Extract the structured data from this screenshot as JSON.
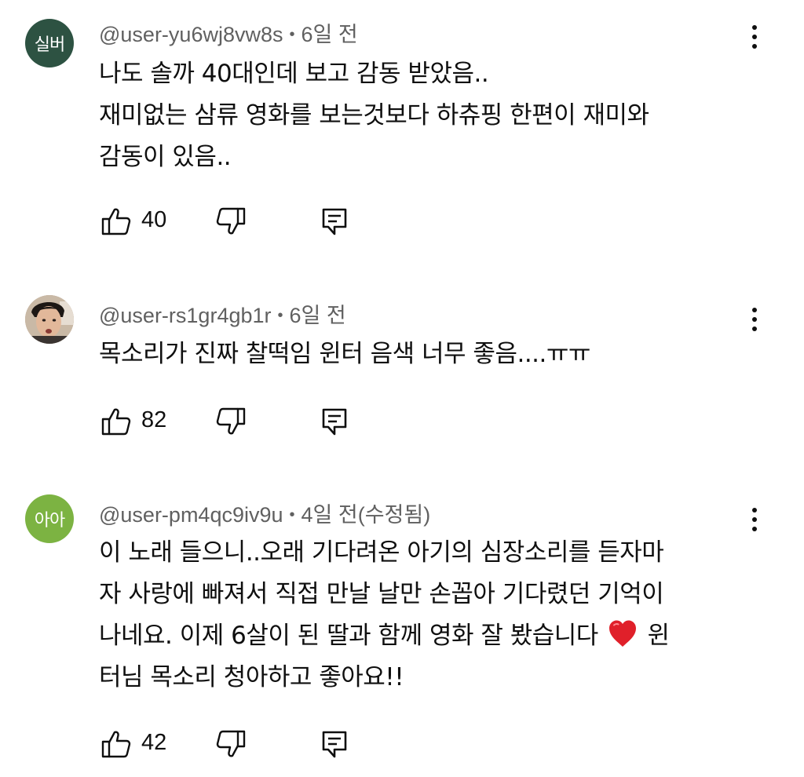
{
  "comments": [
    {
      "avatar_text": "실버",
      "avatar_color": "#2d5242",
      "username": "@user-yu6wj8vw8s",
      "time": "6일 전",
      "lines": [
        "나도 솔까 40대인데 보고 감동 받았음..",
        "재미없는 삼류 영화를 보는것보다 하츄핑 한편이 재미와",
        "감동이 있음.."
      ],
      "likes": "40"
    },
    {
      "avatar_text": "",
      "avatar_color": "#b8a48e",
      "username": "@user-rs1gr4gb1r",
      "time": "6일 전",
      "lines": [
        "목소리가 진짜 찰떡임 윈터 음색 너무 좋음....ㅠㅠ"
      ],
      "likes": "82"
    },
    {
      "avatar_text": "아아",
      "avatar_color": "#7cb342",
      "username": "@user-pm4qc9iv9u",
      "time": "4일 전(수정됨)",
      "lines": [
        "이 노래 들으니..오래 기다려온 아기의 심장소리를 듣자마",
        "자 사랑에 빠져서 직접 만날 날만 손꼽아 기다렸던 기억이",
        "나네요. 이제 6살이 된 딸과 함께 영화 잘 봤습니다",
        "윈",
        "터님 목소리 청아하고 좋아요!!"
      ],
      "likes": "42"
    }
  ],
  "icons": {
    "like": "thumb-up-icon",
    "dislike": "thumb-down-icon",
    "reply": "reply-icon",
    "more": "more-vert-icon",
    "heart": "red-heart-emoji"
  },
  "colors": {
    "heart": "#e0202a",
    "meta": "#606060"
  }
}
